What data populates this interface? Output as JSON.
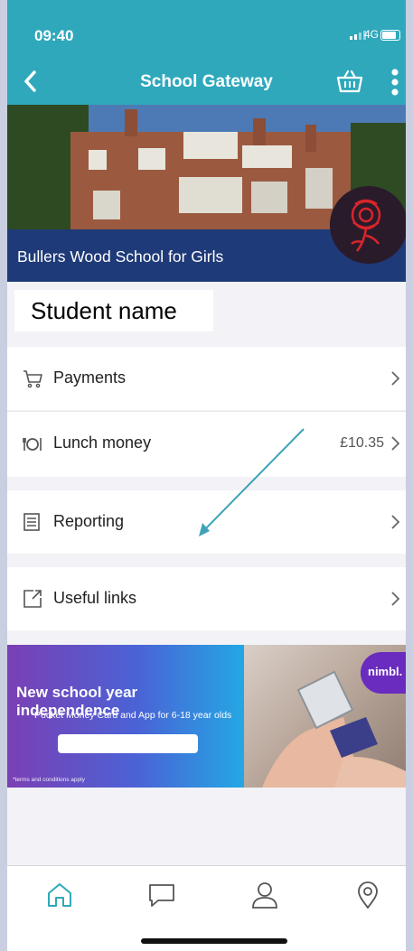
{
  "status_bar": {
    "time": "09:40",
    "network": "4G"
  },
  "header": {
    "title": "School Gateway"
  },
  "hero": {
    "school_name": "Bullers Wood School for Girls"
  },
  "student": {
    "label": "Student name"
  },
  "menu": {
    "payments": {
      "label": "Payments"
    },
    "lunch": {
      "label": "Lunch money",
      "value": "£10.35"
    },
    "reporting": {
      "label": "Reporting"
    },
    "links": {
      "label": "Useful links"
    }
  },
  "banner": {
    "headline": "New school year independence",
    "subline": "Pocket Money Card and App for 6-18 year olds",
    "terms": "*terms and conditions apply",
    "brand": "nimbl."
  },
  "tabbar": {
    "items": [
      "home-icon",
      "chat-icon",
      "user-icon",
      "location-icon"
    ]
  },
  "colors": {
    "header_teal": "#2fa8bc",
    "hero_band": "#1f3a78",
    "annotation_arrow": "#3ea3b8"
  }
}
